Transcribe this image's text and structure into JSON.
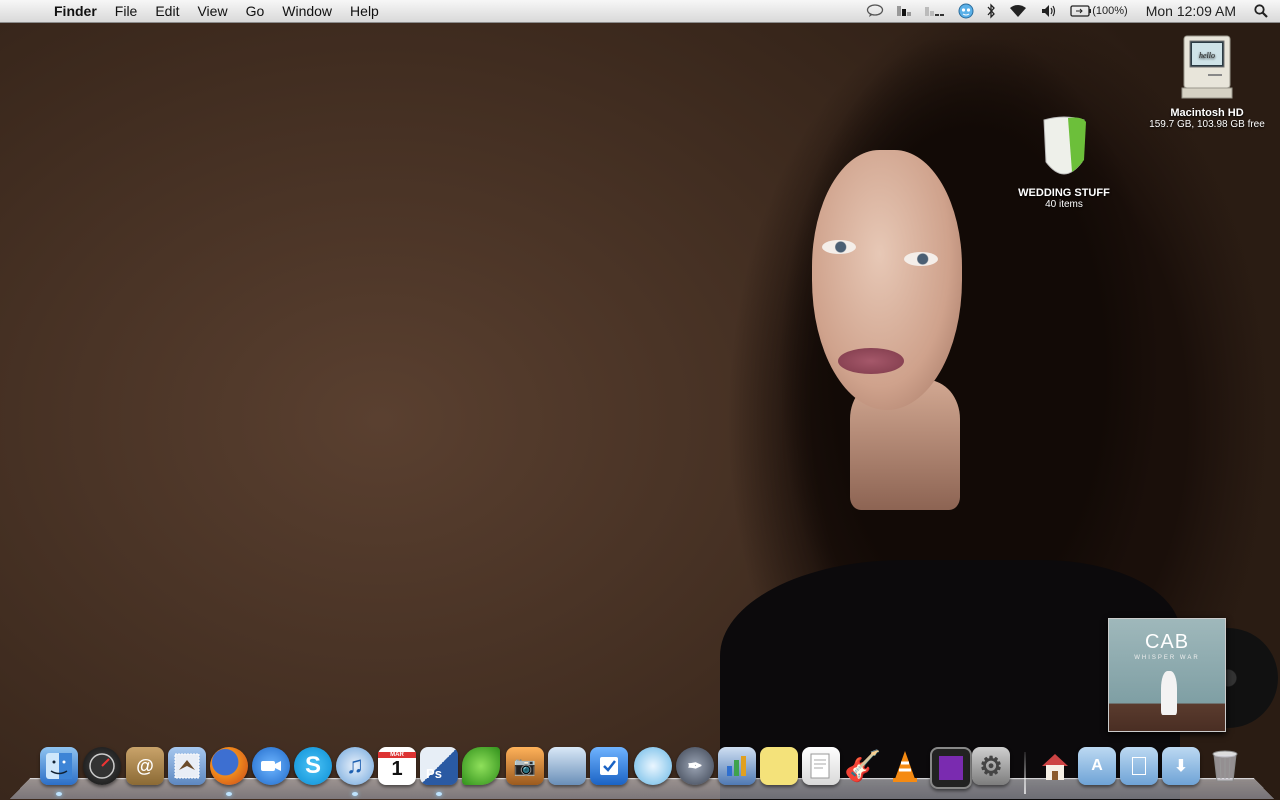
{
  "menubar": {
    "app_name": "Finder",
    "menus": [
      "File",
      "Edit",
      "View",
      "Go",
      "Window",
      "Help"
    ],
    "battery": "(100%)",
    "clock": "Mon 12:09 AM"
  },
  "desktop_icons": {
    "hd": {
      "label": "Macintosh HD",
      "sub": "159.7 GB, 103.98 GB free",
      "screen_text": "hello"
    },
    "folder": {
      "label": "WEDDING STUFF",
      "sub": "40 items"
    }
  },
  "album": {
    "band": "CAB",
    "subtitle": "WHISPER WAR"
  },
  "dock": {
    "items": [
      "Finder",
      "Dashboard",
      "Address Book",
      "Mail",
      "Firefox",
      "iChat",
      "Skype",
      "iTunes",
      "iCal",
      "Photoshop",
      "Growl",
      "iPhoto",
      "Preview",
      "Things",
      "Twitterrific",
      "Script Editor",
      "Keynote",
      "Stickies",
      "TextEdit",
      "GarageBand",
      "VLC",
      "Front Row",
      "System Preferences",
      "Home",
      "Applications",
      "Documents",
      "Downloads",
      "Trash"
    ],
    "ical_day": "1",
    "ical_month": "MAR",
    "ps_label": "Ps"
  }
}
